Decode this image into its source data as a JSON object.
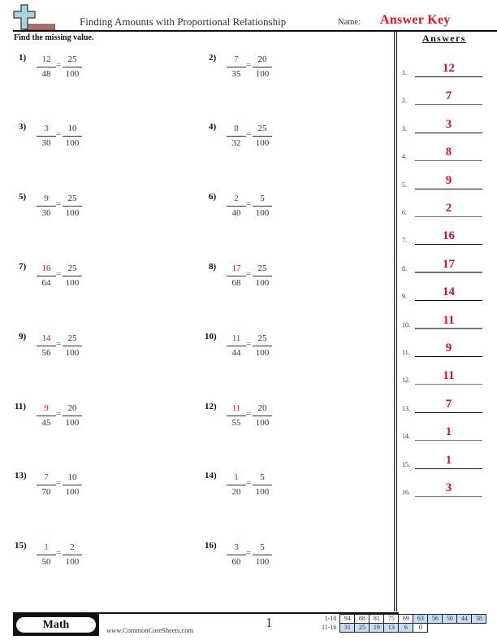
{
  "header": {
    "logo_icon": "plus-cross-icon",
    "title": "Finding Amounts with Proportional Relationship",
    "name_label": "Name:",
    "name_value": "Answer Key"
  },
  "instructions": "Find the missing value.",
  "colors": {
    "answer_red": "#e8101e",
    "text": "#222222",
    "score_blue": "#c7dcf5",
    "logo_blue": "#a9d4df",
    "logo_brick": "#b56a6a"
  },
  "problems": [
    {
      "label": "1)",
      "answer": "12",
      "den": "48",
      "ref_num": "25",
      "ref_den": "100"
    },
    {
      "label": "2)",
      "answer": "7",
      "den": "35",
      "ref_num": "20",
      "ref_den": "100"
    },
    {
      "label": "3)",
      "answer": "3",
      "den": "30",
      "ref_num": "10",
      "ref_den": "100"
    },
    {
      "label": "4)",
      "answer": "8",
      "den": "32",
      "ref_num": "25",
      "ref_den": "100"
    },
    {
      "label": "5)",
      "answer": "9",
      "den": "36",
      "ref_num": "25",
      "ref_den": "100"
    },
    {
      "label": "6)",
      "answer": "2",
      "den": "40",
      "ref_num": "5",
      "ref_den": "100"
    },
    {
      "label": "7)",
      "answer": "16",
      "den": "64",
      "ref_num": "25",
      "ref_den": "100"
    },
    {
      "label": "8)",
      "answer": "17",
      "den": "68",
      "ref_num": "25",
      "ref_den": "100"
    },
    {
      "label": "9)",
      "answer": "14",
      "den": "56",
      "ref_num": "25",
      "ref_den": "100"
    },
    {
      "label": "10)",
      "answer": "11",
      "den": "44",
      "ref_num": "25",
      "ref_den": "100"
    },
    {
      "label": "11)",
      "answer": "9",
      "den": "45",
      "ref_num": "20",
      "ref_den": "100"
    },
    {
      "label": "12)",
      "answer": "11",
      "den": "55",
      "ref_num": "20",
      "ref_den": "100"
    },
    {
      "label": "13)",
      "answer": "7",
      "den": "70",
      "ref_num": "10",
      "ref_den": "100"
    },
    {
      "label": "14)",
      "answer": "1",
      "den": "20",
      "ref_num": "5",
      "ref_den": "100"
    },
    {
      "label": "15)",
      "answer": "1",
      "den": "50",
      "ref_num": "2",
      "ref_den": "100"
    },
    {
      "label": "16)",
      "answer": "3",
      "den": "60",
      "ref_num": "5",
      "ref_den": "100"
    }
  ],
  "answers_panel": {
    "title": "Answers",
    "items": [
      {
        "num": "1.",
        "value": "12"
      },
      {
        "num": "2.",
        "value": "7"
      },
      {
        "num": "3.",
        "value": "3"
      },
      {
        "num": "4.",
        "value": "8"
      },
      {
        "num": "5.",
        "value": "9"
      },
      {
        "num": "6.",
        "value": "2"
      },
      {
        "num": "7.",
        "value": "16"
      },
      {
        "num": "8.",
        "value": "17"
      },
      {
        "num": "9.",
        "value": "14"
      },
      {
        "num": "10.",
        "value": "11"
      },
      {
        "num": "11.",
        "value": "9"
      },
      {
        "num": "12.",
        "value": "11"
      },
      {
        "num": "13.",
        "value": "7"
      },
      {
        "num": "14.",
        "value": "1"
      },
      {
        "num": "15.",
        "value": "1"
      },
      {
        "num": "16.",
        "value": "3"
      }
    ]
  },
  "footer": {
    "subject": "Math",
    "website": "www.CommonCoreSheets.com",
    "page_number": "1",
    "score_table": {
      "rows": [
        {
          "label": "1-10",
          "cells": [
            {
              "v": "94",
              "blue": false
            },
            {
              "v": "88",
              "blue": false
            },
            {
              "v": "81",
              "blue": false
            },
            {
              "v": "75",
              "blue": false
            },
            {
              "v": "69",
              "blue": false
            },
            {
              "v": "63",
              "blue": true
            },
            {
              "v": "56",
              "blue": true
            },
            {
              "v": "50",
              "blue": true
            },
            {
              "v": "44",
              "blue": true
            },
            {
              "v": "38",
              "blue": true
            }
          ]
        },
        {
          "label": "11-16",
          "cells": [
            {
              "v": "31",
              "blue": true
            },
            {
              "v": "25",
              "blue": true
            },
            {
              "v": "19",
              "blue": true
            },
            {
              "v": "13",
              "blue": true
            },
            {
              "v": "6",
              "blue": true
            },
            {
              "v": "0",
              "blue": false
            }
          ]
        }
      ]
    }
  }
}
